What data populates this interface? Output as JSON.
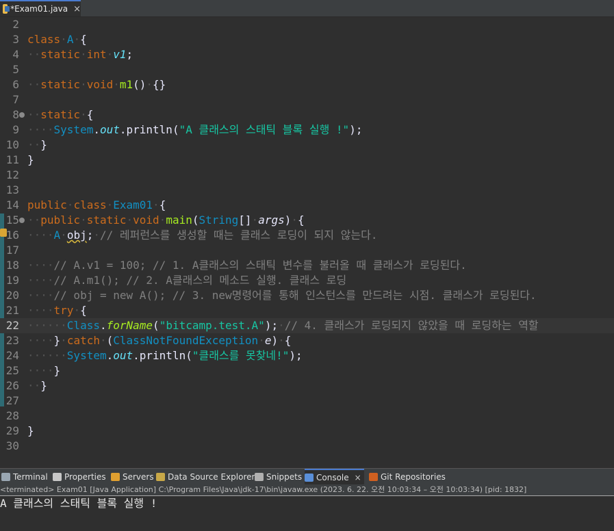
{
  "editor_tab": {
    "title": "*Exam01.java",
    "close": "×"
  },
  "lines": [
    {
      "n": "2",
      "segs": []
    },
    {
      "n": "3",
      "segs": [
        {
          "c": "kw",
          "t": "class"
        },
        {
          "c": "ws",
          "t": "·"
        },
        {
          "c": "cls",
          "t": "A"
        },
        {
          "c": "ws",
          "t": "·"
        },
        {
          "c": "op",
          "t": "{"
        }
      ]
    },
    {
      "n": "4",
      "segs": [
        {
          "c": "ws",
          "t": "··"
        },
        {
          "c": "kw",
          "t": "static"
        },
        {
          "c": "ws",
          "t": "·"
        },
        {
          "c": "kw",
          "t": "int"
        },
        {
          "c": "ws",
          "t": "·"
        },
        {
          "c": "fld",
          "t": "v1"
        },
        {
          "c": "op",
          "t": ";"
        }
      ]
    },
    {
      "n": "5",
      "segs": []
    },
    {
      "n": "6",
      "segs": [
        {
          "c": "ws",
          "t": "··"
        },
        {
          "c": "kw",
          "t": "static"
        },
        {
          "c": "ws",
          "t": "·"
        },
        {
          "c": "kw",
          "t": "void"
        },
        {
          "c": "ws",
          "t": "·"
        },
        {
          "c": "mth",
          "t": "m1"
        },
        {
          "c": "op",
          "t": "()"
        },
        {
          "c": "ws",
          "t": "·"
        },
        {
          "c": "op",
          "t": "{}"
        }
      ]
    },
    {
      "n": "7",
      "segs": []
    },
    {
      "n": "8",
      "fold": true,
      "segs": [
        {
          "c": "ws",
          "t": "··"
        },
        {
          "c": "kw",
          "t": "static"
        },
        {
          "c": "ws",
          "t": "·"
        },
        {
          "c": "op",
          "t": "{"
        }
      ]
    },
    {
      "n": "9",
      "segs": [
        {
          "c": "ws",
          "t": "····"
        },
        {
          "c": "cls",
          "t": "System"
        },
        {
          "c": "op",
          "t": "."
        },
        {
          "c": "fld",
          "t": "out"
        },
        {
          "c": "op",
          "t": ".println("
        },
        {
          "c": "str",
          "t": "\"A 클래스의 스태틱 블록 실행 !\""
        },
        {
          "c": "op",
          "t": ");"
        }
      ]
    },
    {
      "n": "10",
      "segs": [
        {
          "c": "ws",
          "t": "··"
        },
        {
          "c": "op",
          "t": "}"
        }
      ]
    },
    {
      "n": "11",
      "segs": [
        {
          "c": "op",
          "t": "}"
        }
      ]
    },
    {
      "n": "12",
      "segs": []
    },
    {
      "n": "13",
      "segs": []
    },
    {
      "n": "14",
      "segs": [
        {
          "c": "kw",
          "t": "public"
        },
        {
          "c": "ws",
          "t": "·"
        },
        {
          "c": "kw",
          "t": "class"
        },
        {
          "c": "ws",
          "t": "·"
        },
        {
          "c": "cls",
          "t": "Exam01"
        },
        {
          "c": "ws",
          "t": "·"
        },
        {
          "c": "op",
          "t": "{"
        }
      ]
    },
    {
      "n": "15",
      "fold": true,
      "segs": [
        {
          "c": "ws",
          "t": "··"
        },
        {
          "c": "kw",
          "t": "public"
        },
        {
          "c": "ws",
          "t": "·"
        },
        {
          "c": "kw",
          "t": "static"
        },
        {
          "c": "ws",
          "t": "·"
        },
        {
          "c": "kw",
          "t": "void"
        },
        {
          "c": "ws",
          "t": "·"
        },
        {
          "c": "mth",
          "t": "main"
        },
        {
          "c": "op",
          "t": "("
        },
        {
          "c": "cls",
          "t": "String"
        },
        {
          "c": "op",
          "t": "[]"
        },
        {
          "c": "ws",
          "t": "·"
        },
        {
          "c": "op ital",
          "t": "args"
        },
        {
          "c": "op",
          "t": ")"
        },
        {
          "c": "ws",
          "t": "·"
        },
        {
          "c": "op",
          "t": "{"
        }
      ]
    },
    {
      "n": "16",
      "segs": [
        {
          "c": "ws",
          "t": "····"
        },
        {
          "c": "cls",
          "t": "A"
        },
        {
          "c": "ws",
          "t": "·"
        },
        {
          "c": "op squiggle",
          "t": "obj"
        },
        {
          "c": "op",
          "t": ";"
        },
        {
          "c": "ws",
          "t": "·"
        },
        {
          "c": "cmt",
          "t": "// 레퍼런스를 생성할 때는 클래스 로딩이 되지 않는다."
        }
      ]
    },
    {
      "n": "17",
      "segs": []
    },
    {
      "n": "18",
      "segs": [
        {
          "c": "ws",
          "t": "····"
        },
        {
          "c": "cmt",
          "t": "// A.v1 = 100; // 1. A클래스의 스태틱 변수를 불러올 때 클래스가 로딩된다."
        }
      ]
    },
    {
      "n": "19",
      "segs": [
        {
          "c": "ws",
          "t": "····"
        },
        {
          "c": "cmt",
          "t": "// A.m1(); // 2. A클래스의 메소드 실행. 클래스 로딩"
        }
      ]
    },
    {
      "n": "20",
      "segs": [
        {
          "c": "ws",
          "t": "····"
        },
        {
          "c": "cmt",
          "t": "// obj = new A(); // 3. new명령어를 통해 인스턴스를 만드려는 시점. 클래스가 로딩된다."
        }
      ]
    },
    {
      "n": "21",
      "segs": [
        {
          "c": "ws",
          "t": "····"
        },
        {
          "c": "kw",
          "t": "try"
        },
        {
          "c": "ws",
          "t": "·"
        },
        {
          "c": "op",
          "t": "{"
        }
      ]
    },
    {
      "n": "22",
      "current": true,
      "segs": [
        {
          "c": "ws",
          "t": "······"
        },
        {
          "c": "cls",
          "t": "Class"
        },
        {
          "c": "op",
          "t": "."
        },
        {
          "c": "mth ital",
          "t": "forName"
        },
        {
          "c": "op",
          "t": "("
        },
        {
          "c": "str",
          "t": "\"bitcamp.test.A\""
        },
        {
          "c": "op",
          "t": ");"
        },
        {
          "c": "ws",
          "t": "·"
        },
        {
          "c": "cmt",
          "t": "// 4. 클래스가 로딩되지 않았을 때 로딩하는 역할"
        }
      ]
    },
    {
      "n": "23",
      "segs": [
        {
          "c": "ws",
          "t": "····"
        },
        {
          "c": "op",
          "t": "}"
        },
        {
          "c": "ws",
          "t": "·"
        },
        {
          "c": "kw",
          "t": "catch"
        },
        {
          "c": "ws",
          "t": "·"
        },
        {
          "c": "op",
          "t": "("
        },
        {
          "c": "cls",
          "t": "ClassNotFoundException"
        },
        {
          "c": "ws",
          "t": "·"
        },
        {
          "c": "op ital",
          "t": "e"
        },
        {
          "c": "op",
          "t": ")"
        },
        {
          "c": "ws",
          "t": "·"
        },
        {
          "c": "op",
          "t": "{"
        }
      ]
    },
    {
      "n": "24",
      "segs": [
        {
          "c": "ws",
          "t": "······"
        },
        {
          "c": "cls",
          "t": "System"
        },
        {
          "c": "op",
          "t": "."
        },
        {
          "c": "fld",
          "t": "out"
        },
        {
          "c": "op",
          "t": ".println("
        },
        {
          "c": "str",
          "t": "\"클래스를 못찾네!\""
        },
        {
          "c": "op",
          "t": ");"
        }
      ]
    },
    {
      "n": "25",
      "segs": [
        {
          "c": "ws",
          "t": "····"
        },
        {
          "c": "op",
          "t": "}"
        }
      ]
    },
    {
      "n": "26",
      "segs": [
        {
          "c": "ws",
          "t": "··"
        },
        {
          "c": "op",
          "t": "}"
        }
      ]
    },
    {
      "n": "27",
      "segs": []
    },
    {
      "n": "28",
      "segs": []
    },
    {
      "n": "29",
      "segs": [
        {
          "c": "op",
          "t": "}"
        }
      ]
    },
    {
      "n": "30",
      "segs": []
    }
  ],
  "panel_tabs": [
    {
      "label": "Terminal",
      "icon": "terminal-icon",
      "color": "#9aa7b3"
    },
    {
      "label": "Properties",
      "icon": "properties-icon",
      "color": "#c7c7c7"
    },
    {
      "label": "Servers",
      "icon": "servers-icon",
      "color": "#e0a030"
    },
    {
      "label": "Data Source Explorer",
      "icon": "database-icon",
      "color": "#c8a848"
    },
    {
      "label": "Snippets",
      "icon": "snippets-icon",
      "color": "#b0b0b0"
    },
    {
      "label": "Console",
      "icon": "console-icon",
      "color": "#5a8fd8",
      "active": true,
      "close": "×"
    },
    {
      "label": "Git Repositories",
      "icon": "git-icon",
      "color": "#d06020"
    }
  ],
  "console": {
    "status": "<terminated> Exam01 [Java Application] C:\\Program Files\\Java\\jdk-17\\bin\\javaw.exe  (2023. 6. 22. 오전 10:03:34 – 오전 10:03:34) [pid: 1832]",
    "output": "A 클래스의 스태틱 블록 실행 !"
  }
}
